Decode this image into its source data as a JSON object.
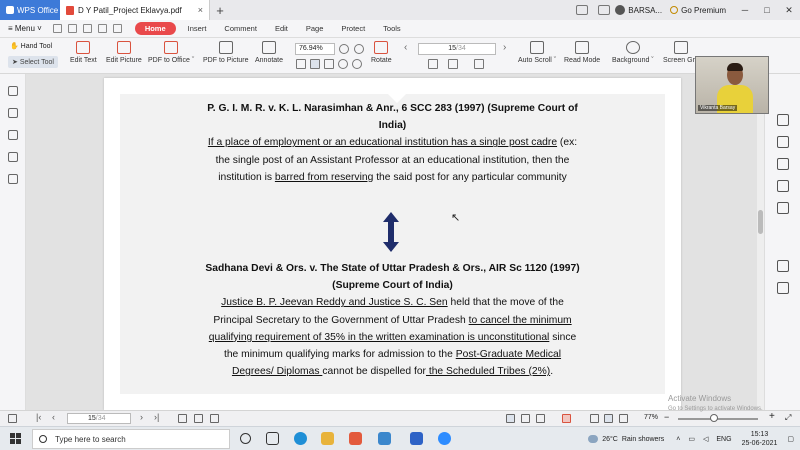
{
  "titlebar": {
    "app_tab": "WPS Office",
    "doc_tab": "D Y Patil_Project Eklavya.pdf",
    "user": "BARSA...",
    "premium": "Go Premium"
  },
  "menubar": {
    "menu": "Menu",
    "items": [
      "Home",
      "Insert",
      "Comment",
      "Edit",
      "Page",
      "Protect",
      "Tools"
    ]
  },
  "toolbar": {
    "hand_tool": "Hand Tool",
    "select_tool": "Select Tool",
    "edit_text": "Edit Text",
    "edit_picture": "Edit Picture",
    "pdf_to_office": "PDF to Office ˇ",
    "pdf_to_picture": "PDF to Picture",
    "annotate": "Annotate",
    "zoom": "76.94%",
    "rotate": "Rotate",
    "page_current": "15",
    "page_total": "/34",
    "auto_scroll": "Auto Scroll ˇ",
    "read_mode": "Read Mode",
    "background": "Background ˇ",
    "screen_grab": "Screen Gra"
  },
  "document": {
    "case1_title_line1": "P. G. I. M. R. v. K. L. Narasimhan & Anr., 6 SCC 283 (1997) (Supreme Court of",
    "case1_title_line2": "India)",
    "case1_l1_u": "If a place of employment or an educational institution has a single post cadre",
    "case1_l1_rest": " (ex:",
    "case1_l2": "the single post of an Assistant Professor at an educational institution, then the",
    "case1_l3_a": "institution is ",
    "case1_l3_u": "barred from reserving",
    "case1_l3_b": " the said post for any particular community",
    "case2_title_line1": "Sadhana Devi & Ors. v. The State of Uttar Pradesh & Ors., AIR Sc 1120 (1997)",
    "case2_title_line2": "(Supreme Court of India)",
    "case2_l1_u": "Justice B. P. Jeevan Reddy and Justice S. C. Sen",
    "case2_l1_rest": " held that the move of the",
    "case2_l2_a": "Principal Secretary to the Government of Uttar Pradesh ",
    "case2_l2_u": "to cancel the minimum",
    "case2_l3_u": "qualifying requirement of 35% in the written examination is unconstitutional",
    "case2_l3_rest": " since",
    "case2_l4_a": "the minimum qualifying marks for admission to the ",
    "case2_l4_u": "Post-Graduate Medical",
    "case2_l5_u1": "Degrees/ Diplomas ",
    "case2_l5_mid": "cannot be dispelled for",
    "case2_l5_u2": " the Scheduled Tribes (2%)",
    "case2_l5_end": "."
  },
  "webcam": {
    "name": "Vikranta Barsay"
  },
  "statusbar": {
    "page_current": "15",
    "page_total": "/34",
    "zoom": "77%"
  },
  "watermark": {
    "line1": "Activate Windows",
    "line2": "Go to Settings to activate Windows."
  },
  "taskbar": {
    "search_placeholder": "Type here to search",
    "weather_temp": "26°C",
    "weather_text": "Rain showers",
    "lang": "ENG",
    "time": "15:13",
    "date": "25-06-2021"
  },
  "colors": {
    "accent_red": "#e9494b",
    "wps_blue": "#3d7ad8",
    "arrow_navy": "#1f2d6b"
  }
}
